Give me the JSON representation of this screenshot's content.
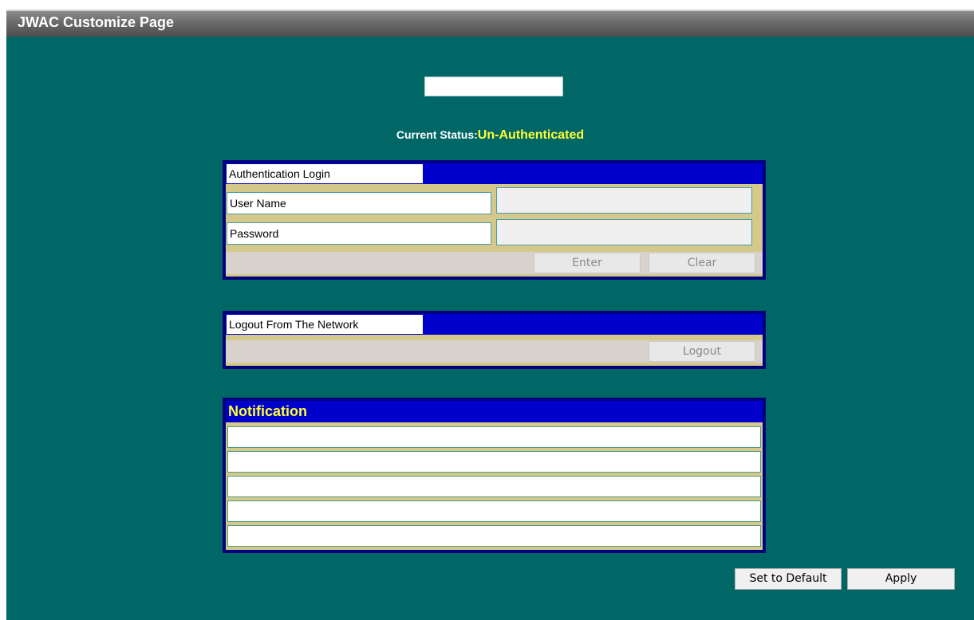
{
  "title": "JWAC Customize Page",
  "top_input": {
    "value": ""
  },
  "status": {
    "label": "Current Status:",
    "value": "Un-Authenticated"
  },
  "auth": {
    "header": "Authentication Login",
    "username_label": "User Name",
    "password_label": "Password",
    "username_value": "",
    "password_value": "",
    "enter": "Enter",
    "clear": "Clear"
  },
  "logout": {
    "header": "Logout From The Network",
    "button": "Logout"
  },
  "notification": {
    "header": "Notification",
    "lines": [
      "",
      "",
      "",
      "",
      ""
    ]
  },
  "buttons": {
    "set_default": "Set to Default",
    "apply": "Apply"
  }
}
